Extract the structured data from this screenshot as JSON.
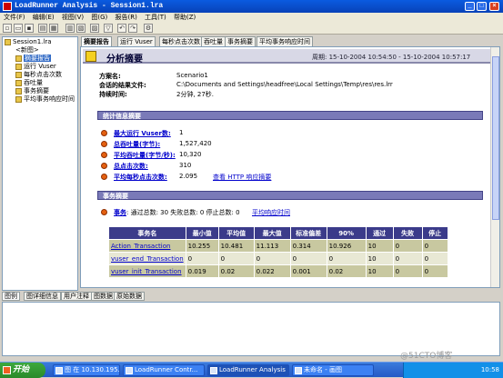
{
  "window": {
    "title": "LoadRunner Analysis - Session1.lra"
  },
  "menu": [
    "文件(F)",
    "编辑(E)",
    "视图(V)",
    "图(G)",
    "报告(R)",
    "工具(T)",
    "帮助(Z)"
  ],
  "tree": {
    "root": "Session1.lra",
    "items": [
      "<新图>",
      "摘要报告",
      "运行 Vuser",
      "每秒点击次数",
      "吞吐量",
      "事务摘要",
      "平均事务响应时间"
    ],
    "selected_index": 1
  },
  "tabs": [
    "摘要报告",
    "运行 Vuser",
    "每秒点击次数",
    "吞吐量",
    "事务摘要",
    "平均事务响应时间"
  ],
  "header": {
    "title": "分析摘要",
    "period": "周期: 15-10-2004 10:54:50 - 15-10-2004 10:57:17"
  },
  "info": {
    "scenario_label": "方案名:",
    "scenario_value": "Scenario1",
    "results_label": "会话的结果文件:",
    "results_value": "C:\\Documents and Settings\\headfree\\Local Settings\\Temp\\res\\res.lrr",
    "duration_label": "持续时间:",
    "duration_value": "2分钟, 27秒."
  },
  "stats": {
    "section_title": "统计信息摘要",
    "rows": [
      {
        "label": "最大运行 Vuser数:",
        "value": "1"
      },
      {
        "label": "总吞吐量(字节):",
        "value": "1,527,420"
      },
      {
        "label": "平均吞吐量(字节/秒):",
        "value": "10,320"
      },
      {
        "label": "总点击次数:",
        "value": "310"
      },
      {
        "label": "平均每秒点击次数:",
        "value": "2.095"
      }
    ],
    "http_link": "查看 HTTP 响应摘要"
  },
  "transactions": {
    "section_title": "事务摘要",
    "link": "事务",
    "summary": ": 通过总数: 30 失败总数: 0 停止总数: 0",
    "avg_link": "平均响应时间",
    "columns": [
      "事务名",
      "最小值",
      "平均值",
      "最大值",
      "标准偏差",
      "90%",
      "通过",
      "失败",
      "停止"
    ],
    "rows": [
      [
        "Action_Transaction",
        "10.255",
        "10.481",
        "11.113",
        "0.314",
        "10.926",
        "10",
        "0",
        "0"
      ],
      [
        "vuser_end_Transaction",
        "0",
        "0",
        "0",
        "0",
        "0",
        "10",
        "0",
        "0"
      ],
      [
        "vuser_init_Transaction",
        "0.019",
        "0.02",
        "0.022",
        "0.001",
        "0.02",
        "10",
        "0",
        "0"
      ]
    ]
  },
  "bottom_tabs": [
    "图例",
    "图详细信息",
    "用户注释",
    "图数据",
    "原始数据"
  ],
  "taskbar": {
    "start": "开始",
    "tasks": [
      "图 在 10.130.195...",
      "LoadRunner Contr...",
      "LoadRunner Analysis",
      "未命名 - 画图"
    ],
    "clock": "10:58"
  },
  "watermark": "@51CTO博客"
}
